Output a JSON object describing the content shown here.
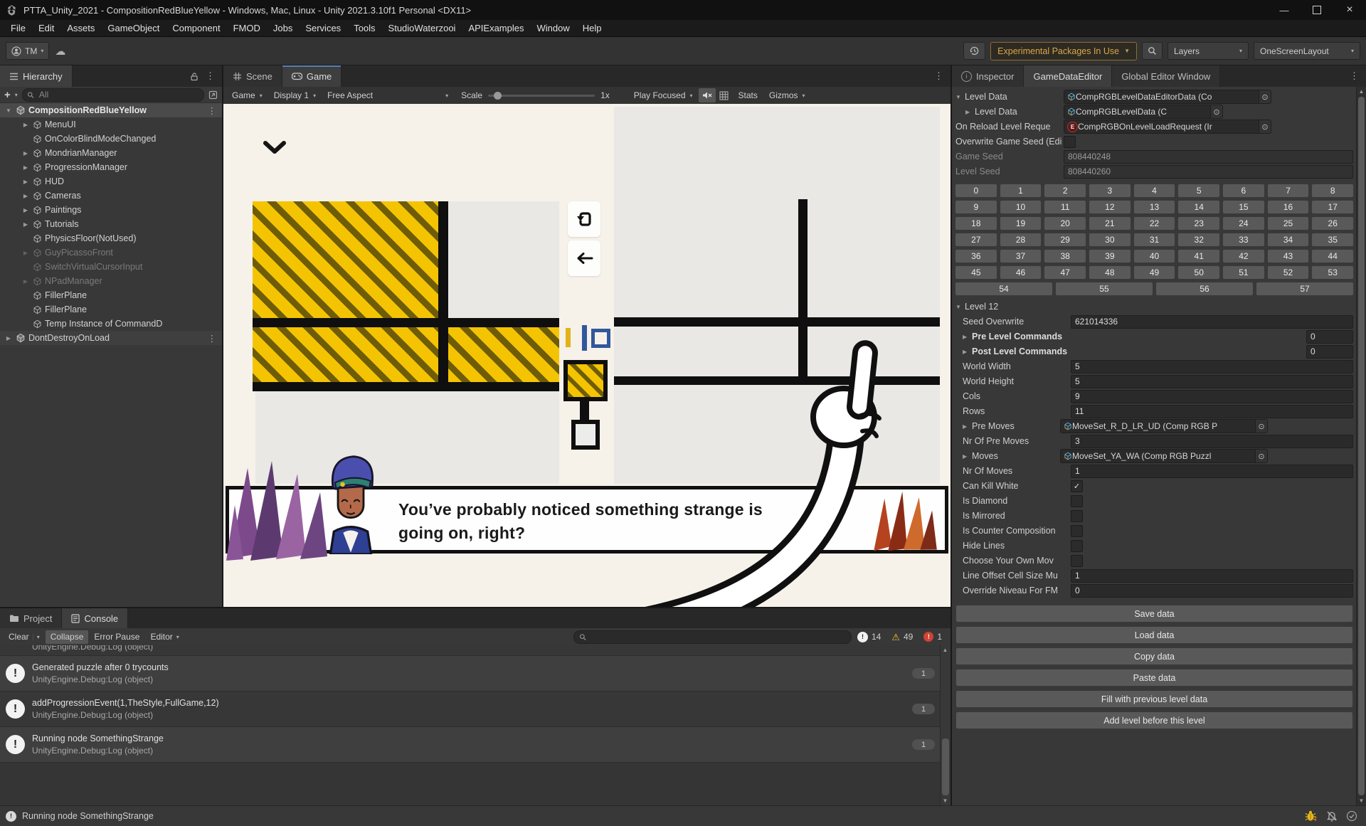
{
  "titlebar": {
    "title": "PTTA_Unity_2021 - CompositionRedBlueYellow - Windows, Mac, Linux - Unity 2021.3.10f1 Personal <DX11>"
  },
  "menu": {
    "items": [
      "File",
      "Edit",
      "Assets",
      "GameObject",
      "Component",
      "FMOD",
      "Jobs",
      "Services",
      "Tools",
      "StudioWaterzooi",
      "APIExamples",
      "Window",
      "Help"
    ]
  },
  "toolbar": {
    "account_label": "TM",
    "packages_button_label": "Experimental Packages In Use",
    "layers_dropdown": "Layers",
    "layout_dropdown": "OneScreenLayout",
    "accent_color": "#d8a845"
  },
  "hierarchy": {
    "tab_label": "Hierarchy",
    "search_placeholder": "All",
    "scene_row": "CompositionRedBlueYellow",
    "items": [
      {
        "label": "MenuUI"
      },
      {
        "label": "OnColorBlindModeChanged"
      },
      {
        "label": "MondrianManager"
      },
      {
        "label": "ProgressionManager"
      },
      {
        "label": "HUD"
      },
      {
        "label": "Cameras"
      },
      {
        "label": "Paintings"
      },
      {
        "label": "Tutorials"
      },
      {
        "label": "PhysicsFloor(NotUsed)"
      },
      {
        "label": "GuyPicassoFront"
      },
      {
        "label": "SwitchVirtualCursorInput"
      },
      {
        "label": "NPadManager"
      },
      {
        "label": "FillerPlane"
      },
      {
        "label": "FillerPlane"
      },
      {
        "label": "Temp Instance of CommandD"
      }
    ],
    "bottom_scene_row": "DontDestroyOnLoad"
  },
  "game": {
    "tab_scene": "Scene",
    "tab_game": "Game",
    "tb": {
      "game_dropdown": "Game",
      "display_dropdown": "Display 1",
      "aspect_dropdown": "Free Aspect",
      "scale_label": "Scale",
      "scale_value": "1x",
      "play_focused_dropdown": "Play Focused",
      "stats_label": "Stats",
      "gizmos_label": "Gizmos"
    },
    "dialogue": {
      "line1": "You’ve probably noticed something strange is",
      "line2": "going on, right?"
    },
    "colors": {
      "yellow": "#f4c402",
      "stripe": "#6f5c08",
      "blue": "#30589c",
      "cream": "#f6f1e9",
      "gray": "#e9e8e5"
    }
  },
  "inspector": {
    "tab_inspector": "Inspector",
    "tab_gde": "GameDataEditor",
    "tab_global": "Global Editor Window",
    "ld": {
      "label": "Level Data",
      "obj": "CompRGBLevelDataEditorData (Co",
      "sub_label": "Level Data",
      "sub_obj": "CompRGBLevelData (C",
      "reload_label": "On Reload Level Reque",
      "reload_obj": "CompRGBOnLevelLoadRequest (Ir",
      "ow_label": "Overwrite Game Seed (Edi",
      "gs_label": "Game Seed",
      "gs": "808440248",
      "ls_label": "Level Seed",
      "ls": "808440260"
    },
    "grid": [
      "0",
      "1",
      "2",
      "3",
      "4",
      "5",
      "6",
      "7",
      "8",
      "9",
      "10",
      "11",
      "12",
      "13",
      "14",
      "15",
      "16",
      "17",
      "18",
      "19",
      "20",
      "21",
      "22",
      "23",
      "24",
      "25",
      "26",
      "27",
      "28",
      "29",
      "30",
      "31",
      "32",
      "33",
      "34",
      "35",
      "36",
      "37",
      "38",
      "39",
      "40",
      "41",
      "42",
      "43",
      "44",
      "45",
      "46",
      "47",
      "48",
      "49",
      "50",
      "51",
      "52",
      "53",
      "54",
      "55",
      "56",
      "57"
    ],
    "lvl": {
      "header": "Level 12",
      "seed_label": "Seed Overwrite",
      "seed": "621014336",
      "pre_label": "Pre Level Commands",
      "pre_n": "0",
      "post_label": "Post Level Commands",
      "post_n": "0",
      "ww_label": "World Width",
      "ww": "5",
      "wh_label": "World Height",
      "wh": "5",
      "cols_label": "Cols",
      "cols": "9",
      "rows_label": "Rows",
      "rows": "11",
      "pm_label": "Pre Moves",
      "pm": "MoveSet_R_D_LR_UD (Comp RGB P",
      "npm_label": "Nr Of Pre Moves",
      "npm": "3",
      "mv_label": "Moves",
      "mv": "MoveSet_YA_WA (Comp RGB Puzzl",
      "nm_label": "Nr Of Moves",
      "nm": "1",
      "ckw_label": "Can Kill White",
      "idia_label": "Is Diamond",
      "imir_label": "Is Mirrored",
      "icc_label": "Is Counter Composition",
      "hl_label": "Hide Lines",
      "cym_label": "Choose Your Own Mov",
      "lo_label": "Line Offset Cell Size Mu",
      "lo": "1",
      "on_label": "Override Niveau For FM",
      "on": "0"
    },
    "buttons": [
      "Save data",
      "Load data",
      "Copy data",
      "Paste data",
      "Fill with previous level data",
      "Add level before this level"
    ]
  },
  "console": {
    "tab_project": "Project",
    "tab_console": "Console",
    "clear": "Clear",
    "collapse": "Collapse",
    "error_pause": "Error Pause",
    "editor": "Editor",
    "n_info": "14",
    "n_warn": "49",
    "n_err": "1",
    "partial_row": "UnityEngine.Debug:Log (object)",
    "rows": [
      {
        "message": "Generated puzzle after 0 trycounts",
        "stack": "UnityEngine.Debug:Log (object)",
        "count": "1"
      },
      {
        "message": "addProgressionEvent(1,TheStyle,FullGame,12)",
        "stack": "UnityEngine.Debug:Log (object)",
        "count": "1"
      },
      {
        "message": "Running node SomethingStrange",
        "stack": "UnityEngine.Debug:Log (object)",
        "count": "1"
      }
    ]
  },
  "status": {
    "message": "Running node SomethingStrange"
  }
}
